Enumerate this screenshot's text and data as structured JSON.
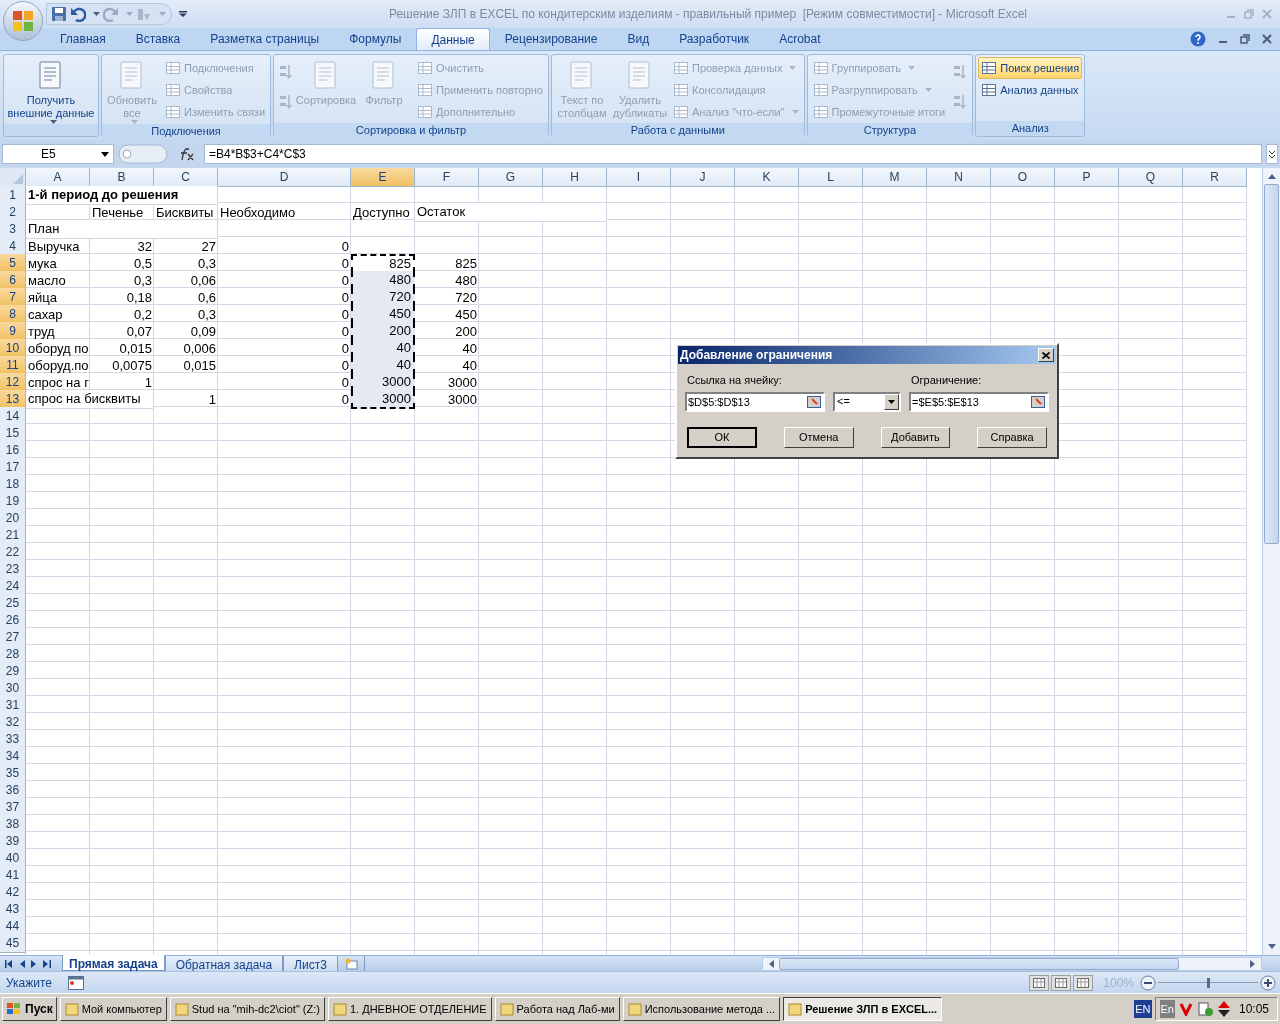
{
  "title_bar": {
    "title": "Решение ЗЛП в EXCEL по кондитерским изделиям - правильный пример  [Режим совместимости] - Microsoft Excel"
  },
  "ribbon_tabs": [
    {
      "label": "Главная",
      "selected": false
    },
    {
      "label": "Вставка",
      "selected": false
    },
    {
      "label": "Разметка страницы",
      "selected": false
    },
    {
      "label": "Формулы",
      "selected": false
    },
    {
      "label": "Данные",
      "selected": true
    },
    {
      "label": "Рецензирование",
      "selected": false
    },
    {
      "label": "Вид",
      "selected": false
    },
    {
      "label": "Разработчик",
      "selected": false
    },
    {
      "label": "Acrobat",
      "selected": false
    }
  ],
  "ribbon_groups": [
    {
      "columns": [
        [
          {
            "kind": "large",
            "label": "Получить внешние данные",
            "disabled": false,
            "dropdown": true
          }
        ]
      ]
    },
    {
      "label": "Подключения",
      "columns": [
        [
          {
            "kind": "large",
            "label": "Обновить все",
            "disabled": true,
            "dropdown": true
          }
        ],
        [
          {
            "kind": "small",
            "label": "Подключения",
            "disabled": true,
            "dropdown": false
          },
          {
            "kind": "small",
            "label": "Свойства",
            "disabled": true,
            "dropdown": false
          },
          {
            "kind": "small",
            "label": "Изменить связи",
            "disabled": true,
            "dropdown": false
          }
        ]
      ]
    },
    {
      "label": "Сортировка и фильтр",
      "columns": [
        [
          {
            "kind": "icon",
            "disabled": true
          },
          {
            "kind": "icon",
            "disabled": true
          }
        ],
        [
          {
            "kind": "large",
            "label": "Сортировка",
            "disabled": true,
            "dropdown": false
          }
        ],
        [
          {
            "kind": "large",
            "label": "Фильтр",
            "disabled": true,
            "dropdown": false
          }
        ],
        [
          {
            "kind": "small",
            "label": "Очистить",
            "disabled": true,
            "dropdown": false
          },
          {
            "kind": "small",
            "label": "Применить повторно",
            "disabled": true,
            "dropdown": false
          },
          {
            "kind": "small",
            "label": "Дополнительно",
            "disabled": true,
            "dropdown": false
          }
        ]
      ]
    },
    {
      "label": "Работа с данными",
      "columns": [
        [
          {
            "kind": "large",
            "label": "Текст по столбцам",
            "disabled": true,
            "dropdown": false
          }
        ],
        [
          {
            "kind": "large",
            "label": "Удалить дубликаты",
            "disabled": true,
            "dropdown": false
          }
        ],
        [
          {
            "kind": "small",
            "label": "Проверка данных",
            "disabled": true,
            "dropdown": true
          },
          {
            "kind": "small",
            "label": "Консолидация",
            "disabled": true,
            "dropdown": false
          },
          {
            "kind": "small",
            "label": "Анализ \"что-если\"",
            "disabled": true,
            "dropdown": true
          }
        ]
      ]
    },
    {
      "label": "Структура",
      "columns": [
        [
          {
            "kind": "small",
            "label": "Группировать",
            "disabled": true,
            "dropdown": true
          },
          {
            "kind": "small",
            "label": "Разгруппировать",
            "disabled": true,
            "dropdown": true
          },
          {
            "kind": "small",
            "label": "Промежуточные итоги",
            "disabled": true,
            "dropdown": false
          }
        ],
        [
          {
            "kind": "icon",
            "disabled": true
          },
          {
            "kind": "icon",
            "disabled": true
          }
        ]
      ]
    },
    {
      "label": "Анализ",
      "columns": [
        [
          {
            "kind": "small",
            "label": "Поиск решения",
            "disabled": false,
            "dropdown": false,
            "highlighted": true
          },
          {
            "kind": "small",
            "label": "Анализ данных",
            "disabled": false,
            "dropdown": false,
            "highlighted": false
          }
        ]
      ]
    }
  ],
  "formula_bar": {
    "name_box": "E5",
    "formula": "=B4*B$3+C4*C$3"
  },
  "sheet": {
    "columns": [
      {
        "label": "A",
        "selected": false
      },
      {
        "label": "B",
        "selected": false
      },
      {
        "label": "C",
        "selected": false
      },
      {
        "label": "D",
        "selected": false
      },
      {
        "label": "E",
        "selected": true
      },
      {
        "label": "F",
        "selected": false
      },
      {
        "label": "G",
        "selected": false
      },
      {
        "label": "H",
        "selected": false
      },
      {
        "label": "I",
        "selected": false
      },
      {
        "label": "J",
        "selected": false
      },
      {
        "label": "K",
        "selected": false
      },
      {
        "label": "L",
        "selected": false
      },
      {
        "label": "M",
        "selected": false
      },
      {
        "label": "N",
        "selected": false
      },
      {
        "label": "O",
        "selected": false
      },
      {
        "label": "P",
        "selected": false
      },
      {
        "label": "Q",
        "selected": false
      },
      {
        "label": "R",
        "selected": false
      }
    ],
    "rows": [
      {
        "number": "1",
        "selected": false,
        "cells": [
          {
            "kind": "text",
            "text": "1-й период до решения",
            "bold": true
          }
        ]
      },
      {
        "number": "2",
        "selected": false,
        "cells": [
          {
            "kind": "empty"
          },
          {
            "kind": "text",
            "text": "Печенье"
          },
          {
            "kind": "text",
            "text": "Бисквиты"
          },
          {
            "kind": "text",
            "text": "Необходимо"
          },
          {
            "kind": "text",
            "text": "Доступно"
          },
          {
            "kind": "text",
            "text": "Остаток"
          }
        ]
      },
      {
        "number": "3",
        "selected": false,
        "cells": [
          {
            "kind": "text",
            "text": "План"
          }
        ]
      },
      {
        "number": "4",
        "selected": false,
        "cells": [
          {
            "kind": "text",
            "text": "Выручка"
          },
          {
            "kind": "number",
            "text": "32"
          },
          {
            "kind": "number",
            "text": "27"
          },
          {
            "kind": "number",
            "text": "0"
          }
        ]
      },
      {
        "number": "5",
        "selected": true,
        "cells": [
          {
            "kind": "text",
            "text": "мука"
          },
          {
            "kind": "number",
            "text": "0,5"
          },
          {
            "kind": "number",
            "text": "0,3"
          },
          {
            "kind": "number",
            "text": "0"
          },
          {
            "kind": "number",
            "text": "825"
          },
          {
            "kind": "number",
            "text": "825"
          }
        ]
      },
      {
        "number": "6",
        "selected": true,
        "cells": [
          {
            "kind": "text",
            "text": "масло"
          },
          {
            "kind": "number",
            "text": "0,3"
          },
          {
            "kind": "number",
            "text": "0,06"
          },
          {
            "kind": "number",
            "text": "0"
          },
          {
            "kind": "number",
            "text": "480"
          },
          {
            "kind": "number",
            "text": "480"
          }
        ]
      },
      {
        "number": "7",
        "selected": true,
        "cells": [
          {
            "kind": "text",
            "text": "яйца"
          },
          {
            "kind": "number",
            "text": "0,18"
          },
          {
            "kind": "number",
            "text": "0,6"
          },
          {
            "kind": "number",
            "text": "0"
          },
          {
            "kind": "number",
            "text": "720"
          },
          {
            "kind": "number",
            "text": "720"
          }
        ]
      },
      {
        "number": "8",
        "selected": true,
        "cells": [
          {
            "kind": "text",
            "text": "сахар"
          },
          {
            "kind": "number",
            "text": "0,2"
          },
          {
            "kind": "number",
            "text": "0,3"
          },
          {
            "kind": "number",
            "text": "0"
          },
          {
            "kind": "number",
            "text": "450"
          },
          {
            "kind": "number",
            "text": "450"
          }
        ]
      },
      {
        "number": "9",
        "selected": true,
        "cells": [
          {
            "kind": "text",
            "text": "труд"
          },
          {
            "kind": "number",
            "text": "0,07"
          },
          {
            "kind": "number",
            "text": "0,09"
          },
          {
            "kind": "number",
            "text": "0"
          },
          {
            "kind": "number",
            "text": "200"
          },
          {
            "kind": "number",
            "text": "200"
          }
        ]
      },
      {
        "number": "10",
        "selected": true,
        "cells": [
          {
            "kind": "text",
            "text": "оборуд по"
          },
          {
            "kind": "number",
            "text": "0,015"
          },
          {
            "kind": "number",
            "text": "0,006"
          },
          {
            "kind": "number",
            "text": "0"
          },
          {
            "kind": "number",
            "text": "40"
          },
          {
            "kind": "number",
            "text": "40"
          }
        ]
      },
      {
        "number": "11",
        "selected": true,
        "cells": [
          {
            "kind": "text",
            "text": "оборуд.по"
          },
          {
            "kind": "number",
            "text": "0,0075"
          },
          {
            "kind": "number",
            "text": "0,015"
          },
          {
            "kind": "number",
            "text": "0"
          },
          {
            "kind": "number",
            "text": "40"
          },
          {
            "kind": "number",
            "text": "40"
          }
        ]
      },
      {
        "number": "12",
        "selected": true,
        "cells": [
          {
            "kind": "text",
            "text": "спрос на г"
          },
          {
            "kind": "number",
            "text": "1"
          },
          {
            "kind": "empty"
          },
          {
            "kind": "number",
            "text": "0"
          },
          {
            "kind": "number",
            "text": "3000"
          },
          {
            "kind": "number",
            "text": "3000"
          }
        ]
      },
      {
        "number": "13",
        "selected": true,
        "cells": [
          {
            "kind": "text",
            "text": "спрос на бисквиты"
          },
          {
            "kind": "empty"
          },
          {
            "kind": "number",
            "text": "1"
          },
          {
            "kind": "number",
            "text": "0"
          },
          {
            "kind": "number",
            "text": "3000"
          },
          {
            "kind": "number",
            "text": "3000"
          }
        ]
      },
      {
        "number": "14",
        "selected": false
      },
      {
        "number": "15",
        "selected": false
      },
      {
        "number": "16",
        "selected": false
      },
      {
        "number": "17",
        "selected": false
      },
      {
        "number": "18",
        "selected": false
      },
      {
        "number": "19",
        "selected": false
      },
      {
        "number": "20",
        "selected": false
      },
      {
        "number": "21",
        "selected": false
      },
      {
        "number": "22",
        "selected": false
      },
      {
        "number": "23",
        "selected": false
      },
      {
        "number": "24",
        "selected": false
      },
      {
        "number": "25",
        "selected": false
      },
      {
        "number": "26",
        "selected": false
      },
      {
        "number": "27",
        "selected": false
      },
      {
        "number": "28",
        "selected": false
      },
      {
        "number": "29",
        "selected": false
      },
      {
        "number": "30",
        "selected": false
      },
      {
        "number": "31",
        "selected": false
      },
      {
        "number": "32",
        "selected": false
      },
      {
        "number": "33",
        "selected": false
      },
      {
        "number": "34",
        "selected": false
      },
      {
        "number": "35",
        "selected": false
      },
      {
        "number": "36",
        "selected": false
      },
      {
        "number": "37",
        "selected": false
      },
      {
        "number": "38",
        "selected": false
      },
      {
        "number": "39",
        "selected": false
      },
      {
        "number": "40",
        "selected": false
      },
      {
        "number": "41",
        "selected": false
      },
      {
        "number": "42",
        "selected": false
      },
      {
        "number": "43",
        "selected": false
      },
      {
        "number": "44",
        "selected": false
      },
      {
        "number": "45",
        "selected": false
      }
    ]
  },
  "dialog": {
    "title": "Добавление ограничения",
    "reference_label": "Ссылка на ячейку:",
    "reference": "$D$5:$D$13",
    "operator": "<=",
    "constraint_label": "Ограничение:",
    "constraint": "=$E$5:$E$13",
    "buttons": [
      {
        "label": "ОК",
        "default": true
      },
      {
        "label": "Отмена",
        "default": false
      },
      {
        "label": "Добавить",
        "default": false
      },
      {
        "label": "Справка",
        "default": false
      }
    ]
  },
  "sheet_tabs": [
    {
      "label": "Прямая задача",
      "selected": true
    },
    {
      "label": "Обратная задача",
      "selected": false
    },
    {
      "label": "Лист3",
      "selected": false
    }
  ],
  "status_bar": {
    "mode": "Укажите",
    "zoom": {
      "label": "100%",
      "level": 0.5
    }
  },
  "taskbar": {
    "start": "Пуск",
    "tasks": [
      {
        "label": "Мой компьютер",
        "selected": false
      },
      {
        "label": "Stud на \"mih-dc2\\ciot\" (Z:)",
        "selected": false
      },
      {
        "label": "1. ДНЕВНОЕ ОТДЕЛЕНИЕ",
        "selected": false
      },
      {
        "label": "Работа над Лаб-ми",
        "selected": false
      },
      {
        "label": "Использование метода ...",
        "selected": false
      },
      {
        "label": "Решение ЗЛП в EXCEL...",
        "selected": true
      }
    ],
    "tray": {
      "language": "EN",
      "input": "En",
      "time": "10:05"
    }
  }
}
